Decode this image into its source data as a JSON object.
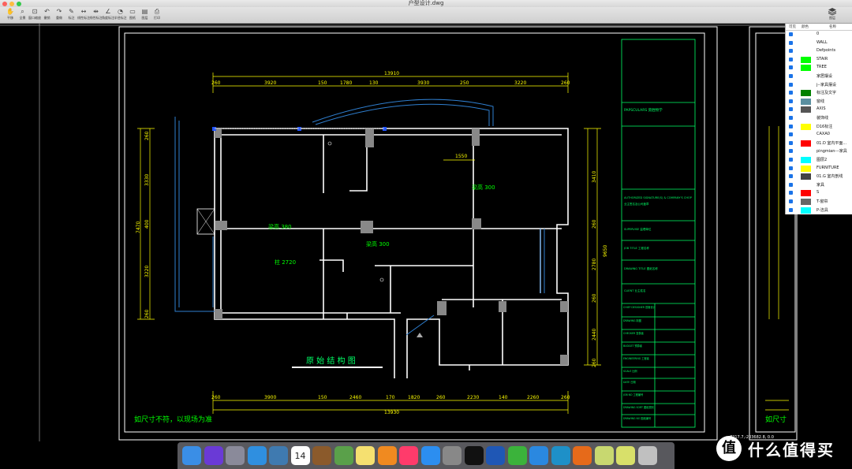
{
  "window": {
    "title": "户型设计.dwg"
  },
  "toolbar": {
    "tools": [
      {
        "label": "平移",
        "icon": "hand-icon"
      },
      {
        "label": "全景",
        "icon": "zoom-extents-icon"
      },
      {
        "label": "窗口缩放",
        "icon": "zoom-window-icon"
      },
      {
        "label": "撤销",
        "icon": "undo-icon"
      },
      {
        "label": "重做",
        "icon": "redo-icon"
      },
      {
        "label": "标注",
        "icon": "annotate-icon"
      },
      {
        "label": "线性标注",
        "icon": "linear-dimension-icon"
      },
      {
        "label": "线性标注",
        "icon": "aligned-dimension-icon"
      },
      {
        "label": "角度标注",
        "icon": "angle-dimension-icon"
      },
      {
        "label": "半径标注",
        "icon": "radius-dimension-icon"
      },
      {
        "label": "图纸",
        "icon": "sheet-icon"
      },
      {
        "label": "图层",
        "icon": "layer-icon"
      },
      {
        "label": "打印",
        "icon": "print-icon"
      }
    ],
    "layers_label": "图层"
  },
  "layer_panel": {
    "headers": [
      "可见",
      "颜色",
      "名称"
    ],
    "layers": [
      {
        "name": "0",
        "color": ""
      },
      {
        "name": "WALL",
        "color": ""
      },
      {
        "name": "Defpoints",
        "color": ""
      },
      {
        "name": "STAIR",
        "color": "#00ff00"
      },
      {
        "name": "TREE",
        "color": "#00ff00"
      },
      {
        "name": "家居摆设",
        "color": ""
      },
      {
        "name": "j--家具摆设",
        "color": ""
      },
      {
        "name": "标注及文字",
        "color": "#008000"
      },
      {
        "name": "窗线",
        "color": "#5a8fa0"
      },
      {
        "name": "AXIS",
        "color": "#555555"
      },
      {
        "name": "装饰线",
        "color": ""
      },
      {
        "name": "D16标注",
        "color": "#ffff00"
      },
      {
        "name": "CAXA0",
        "color": ""
      },
      {
        "name": "01.D 室内平面...",
        "color": "#ff0000"
      },
      {
        "name": "pingmian---家具",
        "color": ""
      },
      {
        "name": "图层2",
        "color": "#00ffff"
      },
      {
        "name": "FURNITURE",
        "color": "#ffff00"
      },
      {
        "name": "01.G 室内剖线",
        "color": "#444444"
      },
      {
        "name": "家具",
        "color": ""
      },
      {
        "name": "S",
        "color": "#ff0000"
      },
      {
        "name": "T-窗帘",
        "color": "#666666"
      },
      {
        "name": "P-洁具",
        "color": "#00ffff"
      }
    ]
  },
  "drawing": {
    "top_total": "13910",
    "top_dims": [
      "260",
      "3920",
      "150",
      "1780",
      "130",
      "3930",
      "250",
      "3220",
      "260"
    ],
    "bottom_total": "13930",
    "bottom_dims": [
      "260",
      "3900",
      "150",
      "2460",
      "170",
      "1820",
      "260",
      "2230",
      "140",
      "2260",
      "260"
    ],
    "left_total": "7470",
    "left_dims": [
      "260",
      "3330",
      "400",
      "3220",
      "260"
    ],
    "right_total": "9650",
    "right_dims": [
      "3410",
      "260",
      "2780",
      "260",
      "2440",
      "260"
    ],
    "inner_dim": "1550",
    "room_labels": [
      "梁高 380",
      "梁高 300",
      "梁高 300",
      "柱 2720"
    ],
    "plan_title": "原 始 结 构 图",
    "note": "如尺寸不符，以现场为准",
    "note_repeat": "如尺寸",
    "coord_readout": "7217.7,-203682.8, 0.0"
  },
  "title_block": {
    "company": "PAPSCULARS 莫胜物学",
    "authorized": "AUTHORIZED SIGNATURE(S) & COMPANY'S CHOP",
    "authorized_cn": "业主签名及公司盖章",
    "supervise": "SUPERVISE 监理单位",
    "job_title": "JOB TITLE 工程名称",
    "drawing": "DRAWING TITLE 图纸名称",
    "client": "CLIENT 业主姓名",
    "rows": [
      "CHIEF DESIGNER 首席设计",
      "DRAWING 制图",
      "CHECKER 复核者",
      "BUDGET 预算者",
      "ENGINEERING 工程者",
      "SCALE 比例",
      "DATE 日期",
      "JOB NO 工程编号",
      "DRAWING SORT 图纸类别",
      "DRAWING NO 图纸编号"
    ]
  },
  "dock": {
    "apps": [
      "finder-icon",
      "siri-icon",
      "launchpad-icon",
      "safari-icon",
      "preview-icon",
      "calendar-icon",
      "notebook-icon",
      "maps-icon",
      "notes-icon",
      "books-icon",
      "music-icon",
      "app-store-icon",
      "system-preferences-icon",
      "qq-icon",
      "word-icon",
      "wechat-icon",
      "baidu-cloud-icon",
      "search-icon",
      "firefox-icon",
      "cad-icon",
      "cad-viewer-icon",
      "trash-icon"
    ],
    "calendar_day": "14"
  },
  "watermark": {
    "text": "什么值得买",
    "symbol": "值"
  }
}
